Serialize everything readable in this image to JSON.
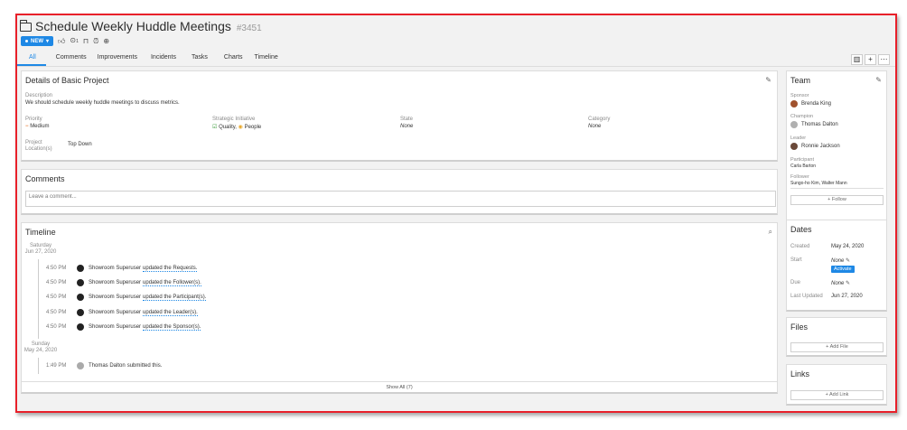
{
  "header": {
    "title": "Schedule Weekly Huddle Meetings",
    "id": "#3451",
    "status": "NEW",
    "like_count": "",
    "check_count": "1"
  },
  "tabs": [
    {
      "label": "All"
    },
    {
      "label": "Comments"
    },
    {
      "label": "Improvements"
    },
    {
      "label": "Incidents"
    },
    {
      "label": "Tasks"
    },
    {
      "label": "Charts"
    },
    {
      "label": "Timeline"
    }
  ],
  "details": {
    "title": "Details of Basic Project",
    "description_label": "Description",
    "description": "We should schedule weekly huddle meetings to discuss metrics.",
    "priority_label": "Priority",
    "priority": "Medium",
    "initiative_label": "Strategic Initiative",
    "initiative_1": "Quality,",
    "initiative_2": "People",
    "state_label": "State",
    "state": "None",
    "category_label": "Category",
    "category": "None",
    "location_label_1": "Project",
    "location_label_2": "Location(s)",
    "location": "Top Down"
  },
  "comments": {
    "title": "Comments",
    "placeholder": "Leave a comment..."
  },
  "timeline": {
    "title": "Timeline",
    "groups": [
      {
        "day": "Saturday",
        "date": "Jun 27, 2020",
        "events": [
          {
            "time": "4:50 PM",
            "user": "Showroom Superuser",
            "action": "updated the Requests."
          },
          {
            "time": "4:50 PM",
            "user": "Showroom Superuser",
            "action": "updated the Follower(s)."
          },
          {
            "time": "4:50 PM",
            "user": "Showroom Superuser",
            "action": "updated the Participant(s)."
          },
          {
            "time": "4:50 PM",
            "user": "Showroom Superuser",
            "action": "updated the Leader(s)."
          },
          {
            "time": "4:50 PM",
            "user": "Showroom Superuser",
            "action": "updated the Sponsor(s)."
          }
        ]
      },
      {
        "day": "Sunday",
        "date": "May 24, 2020",
        "events": [
          {
            "time": "1:49 PM",
            "user": "Thomas Dalton",
            "action": "submitted this."
          }
        ]
      }
    ],
    "show_all": "Show All (7)"
  },
  "team": {
    "title": "Team",
    "sponsor_label": "Sponsor",
    "sponsor": "Brenda King",
    "champion_label": "Champion",
    "champion": "Thomas Dalton",
    "leader_label": "Leader",
    "leader": "Ronnie Jackson",
    "participant_label": "Participant",
    "participant": "Carla Barton",
    "follower_label": "Follower",
    "follower": "Sungo-ho Kim, Walter Mann",
    "follow_button": "Follow"
  },
  "dates": {
    "title": "Dates",
    "created_label": "Created",
    "created": "May 24, 2020",
    "start_label": "Start",
    "start": "None",
    "activate_button": "Activate",
    "due_label": "Due",
    "due": "None",
    "updated_label": "Last Updated",
    "updated": "Jun 27, 2020"
  },
  "files": {
    "title": "Files",
    "add_button": "Add File"
  },
  "links": {
    "title": "Links",
    "add_button": "Add Link"
  },
  "colors": {
    "accent": "#1e88e5",
    "frame": "#e8202a",
    "priority": "#e8742a"
  }
}
